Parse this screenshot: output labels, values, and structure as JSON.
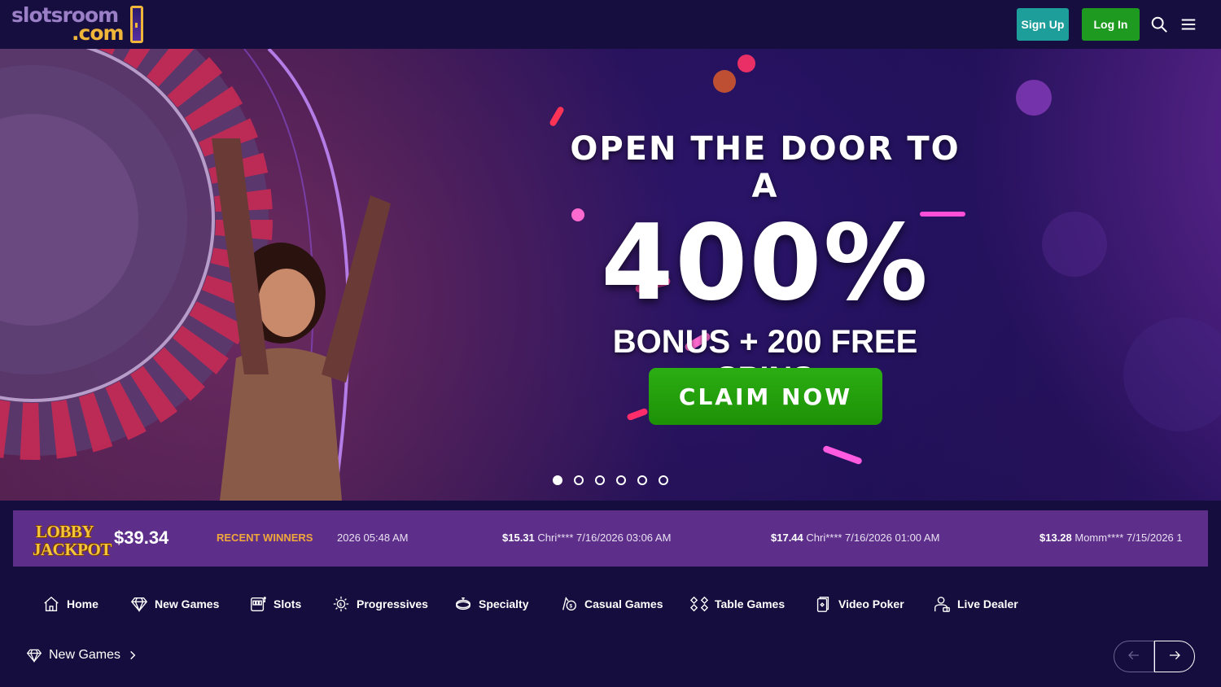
{
  "header": {
    "logo_top": "slotsroom",
    "logo_bottom": ".com",
    "signup_label": "Sign Up",
    "login_label": "Log In",
    "icons": [
      "search-icon",
      "menu-icon"
    ],
    "colors": {
      "signup": "#1e9e9a",
      "login": "#1f9a20"
    }
  },
  "hero": {
    "line1": "OPEN THE DOOR TO A",
    "line2": "400%",
    "line3": "BONUS + 200 FREE SPINS",
    "cta_label": "CLAIM NOW",
    "slide_count": 6,
    "active_slide": 1
  },
  "winners_bar": {
    "jackpot_line1": "LOBBY",
    "jackpot_line2": "JACKPOT",
    "jackpot_amount": "$39.34",
    "recent_label": "RECENT WINNERS",
    "items": [
      {
        "amount": "",
        "text": "2026 05:48 AM"
      },
      {
        "amount": "$15.31",
        "text": " Chri**** 7/16/2026 03:06 AM"
      },
      {
        "amount": "$17.44",
        "text": " Chri**** 7/16/2026 01:00 AM"
      },
      {
        "amount": "$13.28",
        "text": " Momm**** 7/15/2026 1"
      }
    ]
  },
  "categories": [
    {
      "label": "Home",
      "icon": "home-icon"
    },
    {
      "label": "New Games",
      "icon": "diamond-icon"
    },
    {
      "label": "Slots",
      "icon": "slot-machine-icon"
    },
    {
      "label": "Progressives",
      "icon": "progressive-icon"
    },
    {
      "label": "Specialty",
      "icon": "specialty-icon"
    },
    {
      "label": "Casual Games",
      "icon": "casual-icon"
    },
    {
      "label": "Table Games",
      "icon": "table-games-icon"
    },
    {
      "label": "Video Poker",
      "icon": "video-poker-icon"
    },
    {
      "label": "Live Dealer",
      "icon": "live-dealer-icon"
    }
  ],
  "section": {
    "title": "New Games",
    "icon": "diamond-icon"
  }
}
